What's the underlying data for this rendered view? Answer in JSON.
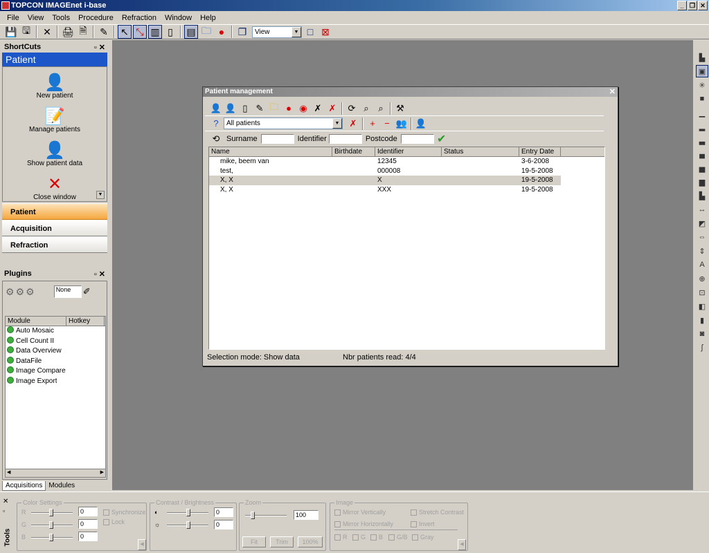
{
  "app": {
    "title": "TOPCON IMAGEnet i-base"
  },
  "menu": [
    "File",
    "View",
    "Tools",
    "Procedure",
    "Refraction",
    "Window",
    "Help"
  ],
  "toolbar": {
    "view_combo": "View"
  },
  "shortcuts": {
    "title": "ShortCuts",
    "section": "Patient",
    "items": [
      {
        "label": "New patient",
        "icon": "new-patient-icon"
      },
      {
        "label": "Manage patients",
        "icon": "manage-patients-icon"
      },
      {
        "label": "Show patient data",
        "icon": "show-patient-data-icon"
      },
      {
        "label": "Close window",
        "icon": "close-window-icon"
      }
    ],
    "nav": [
      "Patient",
      "Acquisition",
      "Refraction"
    ]
  },
  "plugins": {
    "title": "Plugins",
    "filter_value": "None",
    "columns": [
      "Module",
      "Hotkey"
    ],
    "modules": [
      "Auto Mosaic",
      "Cell Count II",
      "Data Overview",
      "DataFile",
      "Image Compare",
      "Image Export"
    ],
    "tabs": [
      "Acquisitions",
      "Modules"
    ]
  },
  "patient_dialog": {
    "title": "Patient management",
    "filter_combo": "All patients",
    "search_labels": {
      "surname": "Surname",
      "identifier": "Identifier",
      "postcode": "Postcode"
    },
    "columns": [
      "Name",
      "Birthdate",
      "Identifier",
      "Status",
      "Entry Date"
    ],
    "rows": [
      {
        "name": "mike, beem van",
        "birthdate": "",
        "identifier": "12345",
        "status": "",
        "entry_date": "3-6-2008"
      },
      {
        "name": "test,",
        "birthdate": "",
        "identifier": "000008",
        "status": "",
        "entry_date": "19-5-2008"
      },
      {
        "name": "X, X",
        "birthdate": "",
        "identifier": "X",
        "status": "",
        "entry_date": "19-5-2008"
      },
      {
        "name": "X, X",
        "birthdate": "",
        "identifier": "XXX",
        "status": "",
        "entry_date": "19-5-2008"
      }
    ],
    "selection_mode": "Selection mode: Show data",
    "patients_read": "Nbr patients read: 4/4"
  },
  "tools": {
    "label": "Tools",
    "color_settings": {
      "title": "Color Settings",
      "r": "R",
      "g": "G",
      "b": "B",
      "r_val": "0",
      "g_val": "0",
      "b_val": "0",
      "synchronize": "Synchronize",
      "lock": "Lock"
    },
    "contrast": {
      "title": "Contrast / Brightness",
      "contrast_val": "0",
      "brightness_val": "0"
    },
    "zoom": {
      "title": "Zoom",
      "value": "100",
      "fit": "Fit",
      "trim": "Trim",
      "pct": "100%"
    },
    "image": {
      "title": "Image",
      "mirror_v": "Mirror Vertically",
      "mirror_h": "Mirror Horizontally",
      "stretch": "Stretch Contrast",
      "invert": "Invert",
      "channels": [
        "R",
        "G",
        "B",
        "G/B",
        "Gray"
      ]
    }
  }
}
